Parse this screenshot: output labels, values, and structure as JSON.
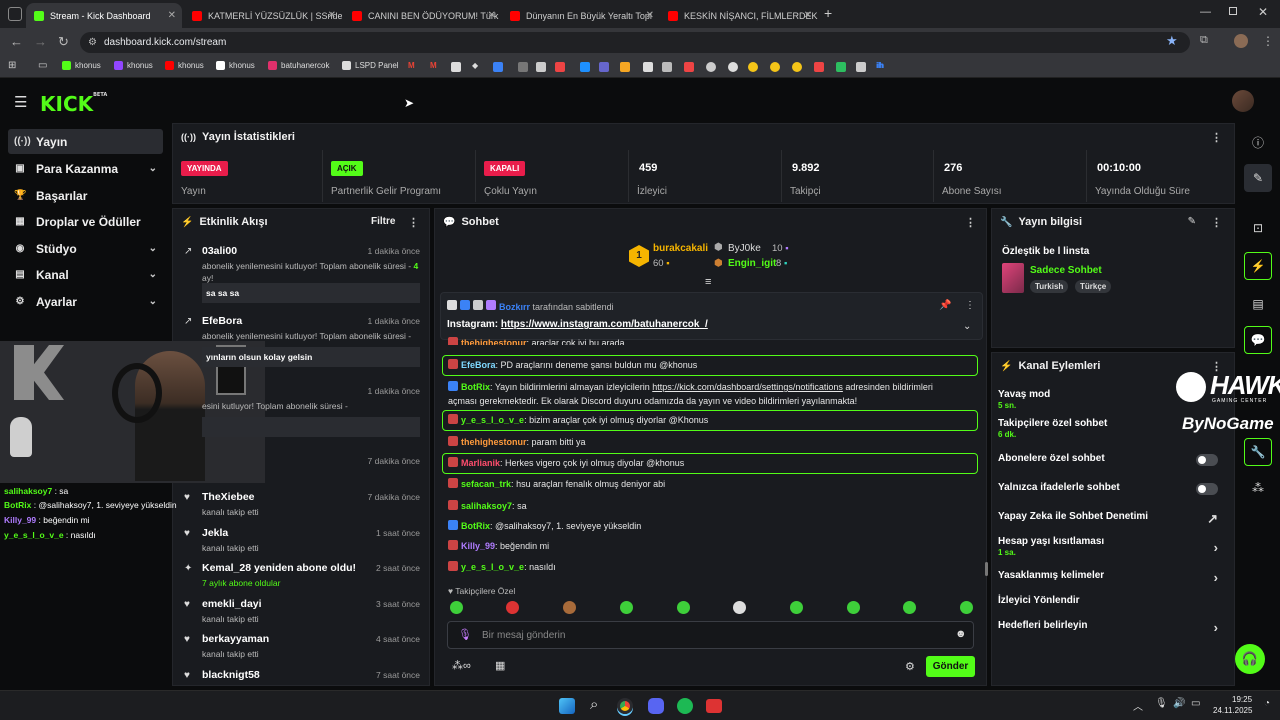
{
  "browser": {
    "tabs": [
      {
        "title": "Stream - Kick Dashboard",
        "color": "#53fc18"
      },
      {
        "title": "KATMERLİ YÜZSÜZLÜK | SSride",
        "color": "#ff0000"
      },
      {
        "title": "CANINI BEN ÖDÜYORUM! Türk",
        "color": "#ff0000"
      },
      {
        "title": "Dünyanın En Büyük Yeraltı Topl",
        "color": "#ff0000"
      },
      {
        "title": "KESKİN NİŞANCI, FİLMLERDEKİ",
        "color": "#ff0000"
      }
    ],
    "url": "dashboard.kick.com/stream",
    "bookmarks": [
      {
        "label": "khonus",
        "color": "#53fc18"
      },
      {
        "label": "khonus",
        "color": "#9146ff"
      },
      {
        "label": "khonus",
        "color": "#ff0000"
      },
      {
        "label": "khonus",
        "color": "#ffffff"
      },
      {
        "label": "batuhanercok",
        "color": "#e1306c"
      },
      {
        "label": "LSPD Panel",
        "color": "#dddddd"
      }
    ],
    "bookmark_glyphs": [
      "M",
      "M",
      "◆",
      "ih",
      "ih"
    ]
  },
  "sidebar": {
    "logo": "KICK",
    "logo_tag": "BETA",
    "items": [
      {
        "label": "Yayın",
        "icon": "((·))",
        "active": true
      },
      {
        "label": "Para Kazanma",
        "icon": "▣",
        "chevron": true
      },
      {
        "label": "Başarılar",
        "icon": "🏆"
      },
      {
        "label": "Droplar ve Ödüller",
        "icon": "▦"
      },
      {
        "label": "Stüdyo",
        "icon": "◉",
        "chevron": true
      },
      {
        "label": "Kanal",
        "icon": "▤",
        "chevron": true
      },
      {
        "label": "Ayarlar",
        "icon": "⚙",
        "chevron": true
      }
    ]
  },
  "stats": {
    "title": "Yayın İstatistikleri",
    "cards": [
      {
        "badge": "YAYINDA",
        "badge_color": "#e91d4b",
        "label": "Yayın"
      },
      {
        "badge": "AÇIK",
        "badge_color": "#53fc18",
        "label": "Partnerlik Gelir Programı"
      },
      {
        "badge": "KAPALI",
        "badge_color": "#e91d4b",
        "label": "Çoklu Yayın"
      },
      {
        "value": "459",
        "label": "İzleyici"
      },
      {
        "value": "9.892",
        "label": "Takipçi"
      },
      {
        "value": "276",
        "label": "Abone Sayısı"
      },
      {
        "value": "00:10:00",
        "label": "Yayında Olduğu Süre"
      }
    ]
  },
  "activity": {
    "title": "Etkinlik Akışı",
    "filter": "Filtre",
    "items": [
      {
        "name": "03ali00",
        "time": "1 dakika önce",
        "sub": "abonelik yenilemesini kutluyor! Toplam abonelik süresi -",
        "extra": "4",
        "extra2": "ay!",
        "msg": "sa sa sa",
        "icon": "↗"
      },
      {
        "name": "EfeBora",
        "time": "1 dakika önce",
        "sub": "abonelik yenilemesini kutluyor! Toplam abonelik süresi -",
        "msg": "yınların olsun kolay gelsin",
        "icon": "↗"
      },
      {
        "name": "",
        "time": "1 dakika önce",
        "sub": "esini kutluyor! Toplam abonelik süresi -",
        "msg": "",
        "icon": ""
      },
      {
        "name": "",
        "time": "7 dakika önce",
        "sub": "",
        "icon": ""
      },
      {
        "name": "TheXiebee",
        "time": "7 dakika önce",
        "sub": "kanalı takip etti",
        "icon": "♥"
      },
      {
        "name": "Jekla",
        "time": "1 saat önce",
        "sub": "kanalı takip etti",
        "icon": "♥"
      },
      {
        "name": "Kemal_28 yeniden abone oldu!",
        "time": "2 saat önce",
        "sub": "7 aylık abone oldular",
        "icon": "✦"
      },
      {
        "name": "emekli_dayi",
        "time": "3 saat önce",
        "sub": "kanalı takip etti",
        "icon": "♥"
      },
      {
        "name": "berkayyaman",
        "time": "4 saat önce",
        "sub": "kanalı takip etti",
        "icon": "♥"
      },
      {
        "name": "blacknigt58",
        "time": "7 saat önce",
        "sub": "",
        "icon": "♥"
      }
    ]
  },
  "overlay_chat": [
    {
      "user": "salihaksoy7",
      "color": "#53fc18",
      "text": "sa"
    },
    {
      "user": "BotRix",
      "color": "#53fc18",
      "text": "@salihaksoy7, 1. seviyeye yükseldin"
    },
    {
      "user": "Killy_99",
      "color": "#b07cff",
      "text": "beğendin mi"
    },
    {
      "user": "y_e_s_l_o_v_e",
      "color": "#53fc18",
      "text": "nasıldı"
    }
  ],
  "chat": {
    "title": "Sohbet",
    "top1": {
      "name": "burakcakali",
      "points": "60",
      "rank": "1"
    },
    "top2": {
      "name": "ByJ0ke",
      "points": "10"
    },
    "top3": {
      "name": "Engin_igit",
      "points": "8"
    },
    "pinned_by": "Bozkırr",
    "pinned_suffix": "tarafından sabitlendi",
    "pinned_label": "Instagram:",
    "pinned_link": "https://www.instagram.com/batuhanercok_/",
    "messages": [
      {
        "user": "thehighestonur",
        "color": "#ff9a3c",
        "text": "araçlar çok iyi bu arada",
        "hl": false
      },
      {
        "user": "EfeBora",
        "color": "#7fd8ff",
        "text": "PD araçlarını deneme şansı buldun mu @khonus",
        "hl": true
      },
      {
        "user": "BotRix",
        "color": "#53fc18",
        "text": "Yayın bildirimlerini almayan izleyicilerin",
        "link": "https://kick.com/dashboard/settings/notifications",
        "tail": "adresinden bildirimleri",
        "line2": "açması gerekmektedir. Ek olarak Discord duyuru odamızda da yayın ve video bildirimleri yayılanmakta!",
        "hl": false
      },
      {
        "user": "y_e_s_l_o_v_e",
        "color": "#53fc18",
        "text": "bizim araçlar çok iyi olmuş diyorlar @Khonus",
        "hl": true
      },
      {
        "user": "thehighestonur",
        "color": "#ff9a3c",
        "text": "param bitti ya",
        "hl": false
      },
      {
        "user": "Marlianik",
        "color": "#ff4d6d",
        "text": "Herkes vigero çok iyi olmuş diyolar @khonus",
        "hl": true
      },
      {
        "user": "sefacan_trk",
        "color": "#53fc18",
        "text": "hsu araçları fenalık olmuş deniyor abi",
        "hl": false
      },
      {
        "user": "salihaksoy7",
        "color": "#53fc18",
        "text": "sa",
        "hl": false
      },
      {
        "user": "BotRix",
        "color": "#53fc18",
        "text": "@salihaksoy7, 1. seviyeye yükseldin",
        "hl": false
      },
      {
        "user": "Killy_99",
        "color": "#b07cff",
        "text": "beğendin mi",
        "hl": false
      },
      {
        "user": "y_e_s_l_o_v_e",
        "color": "#53fc18",
        "text": "nasıldı",
        "hl": false
      }
    ],
    "followers_only": "Takipçilere Özel",
    "input_placeholder": "Bir mesaj gönderin",
    "send": "Gönder"
  },
  "stream_info": {
    "title": "Yayın bilgisi",
    "stream_title": "Özleştik be l linsta",
    "category": "Sadece Sohbet",
    "tags": [
      "Turkish",
      "Türkçe"
    ]
  },
  "channel_actions": {
    "title": "Kanal Eylemleri",
    "items": [
      {
        "label": "Yavaş mod",
        "sub": "5 sn."
      },
      {
        "label": "Takipçilere özel sohbet",
        "sub": "6 dk."
      },
      {
        "label": "Abonelere özel sohbet",
        "toggle": true
      },
      {
        "label": "Yalnızca ifadelerle sohbet",
        "toggle": true
      },
      {
        "label": "Yapay Zeka ile Sohbet Denetimi",
        "arrow": "↗"
      },
      {
        "label": "Hesap yaşı kısıtlaması",
        "sub": "1 sa.",
        "arrow": "›"
      },
      {
        "label": "Yasaklanmış kelimeler",
        "arrow": "›"
      },
      {
        "label": "İzleyici Yönlendir"
      },
      {
        "label": "Hedefleri belirleyin",
        "arrow": "›"
      }
    ]
  },
  "watermark": {
    "brand": "HAWK",
    "sub": "GAMING CENTER",
    "by": "ByNoGame"
  },
  "taskbar": {
    "time": "19:25",
    "date": "24.11.2025"
  }
}
